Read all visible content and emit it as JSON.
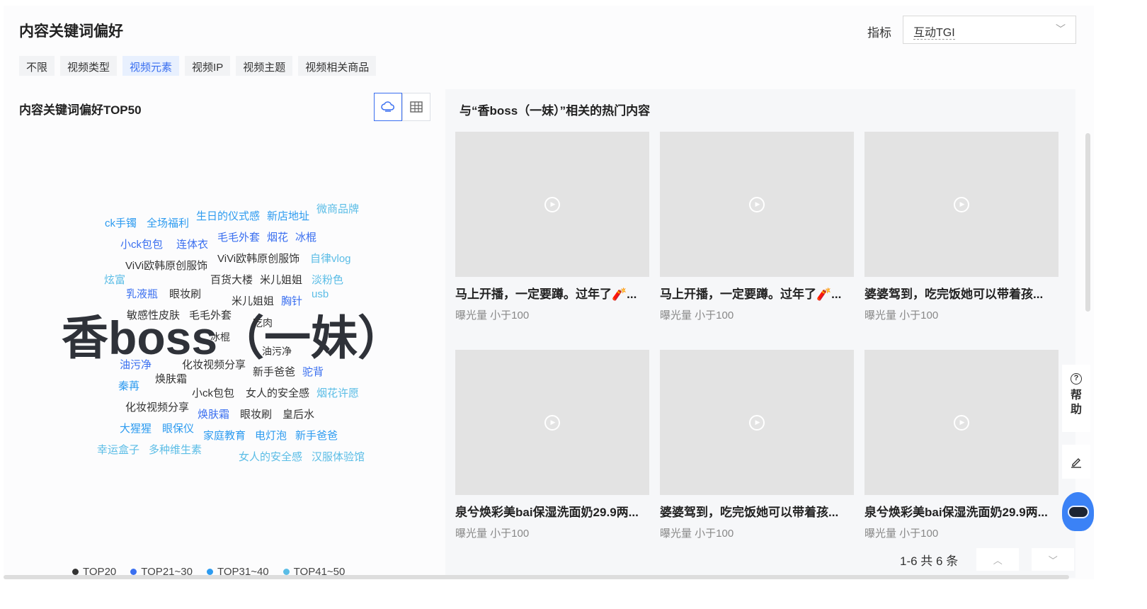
{
  "header": {
    "title": "内容关键词偏好",
    "metric_label": "指标",
    "metric_value": "互动TGI"
  },
  "filters": [
    "不限",
    "视频类型",
    "视频元素",
    "视频IP",
    "视频主题",
    "视频相关商品"
  ],
  "active_filter": "视频元素",
  "left": {
    "title": "内容关键词偏好TOP50"
  },
  "cloud": {
    "main": "香boss（一妹）",
    "words": [
      "微商品牌",
      "ck手镯",
      "全场福利",
      "生日的仪式感",
      "新店地址",
      "小ck包包",
      "连体衣",
      "毛毛外套",
      "烟花",
      "冰棍",
      "ViVi欧韩原创服饰",
      "自律vlog",
      "ViVi欧韩原创服饰",
      "炫富",
      "百货大楼",
      "米儿姐姐",
      "淡粉色",
      "乳液瓶",
      "眼妆刷",
      "usb",
      "米儿姐姐",
      "胸针",
      "敏感性皮肤",
      "毛毛外套",
      "吃肉",
      "冰棍",
      "油污净",
      "油污净",
      "化妆视频分享",
      "新手爸爸",
      "驼背",
      "焕肤霜",
      "秦苒",
      "小ck包包",
      "女人的安全感",
      "烟花许愿",
      "化妆视频分享",
      "焕肤霜",
      "眼妆刷",
      "皇后水",
      "大猩猩",
      "眼保仪",
      "家庭教育",
      "电灯泡",
      "新手爸爸",
      "幸运盒子",
      "多种维生素",
      "女人的安全感",
      "汉服体验馆"
    ]
  },
  "legend": [
    {
      "label": "TOP20",
      "color": "#333333"
    },
    {
      "label": "TOP21~30",
      "color": "#3a6ff0"
    },
    {
      "label": "TOP31~40",
      "color": "#2d9bf0"
    },
    {
      "label": "TOP41~50",
      "color": "#5bbde6"
    }
  ],
  "right": {
    "title": "与“香boss（一妹）”相关的热门内容",
    "cards": [
      {
        "title": "马上开播，一定要蹲。过年了🧨...",
        "meta": "曝光量 小于100"
      },
      {
        "title": "马上开播，一定要蹲。过年了🧨...",
        "meta": "曝光量 小于100"
      },
      {
        "title": "婆婆驾到，吃完饭她可以带着孩...",
        "meta": "曝光量 小于100"
      },
      {
        "title": "泉兮焕彩美bai保湿洗面奶29.9两...",
        "meta": "曝光量 小于100"
      },
      {
        "title": "婆婆驾到，吃完饭她可以带着孩...",
        "meta": "曝光量 小于100"
      },
      {
        "title": "泉兮焕彩美bai保湿洗面奶29.9两...",
        "meta": "曝光量 小于100"
      }
    ],
    "pagination": "1-6 共 6 条"
  },
  "help": "帮助"
}
